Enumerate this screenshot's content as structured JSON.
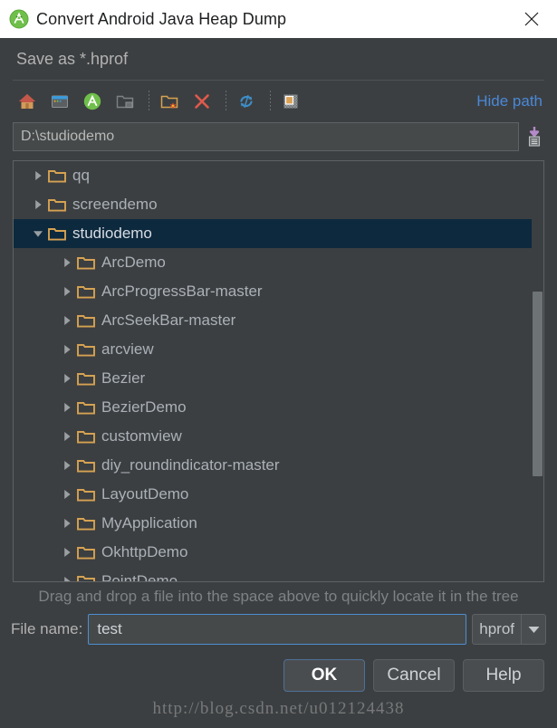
{
  "window": {
    "title": "Convert Android Java Heap Dump",
    "logo_icon": "android-studio-logo",
    "close_icon": "close-icon"
  },
  "dialog": {
    "subheader": "Save as *.hprof"
  },
  "toolbar": {
    "buttons": [
      {
        "name": "home-button",
        "icon": "home-icon",
        "title": "Home"
      },
      {
        "name": "desktop-button",
        "icon": "desktop-icon",
        "title": "Desktop"
      },
      {
        "name": "project-button",
        "icon": "android-studio-icon",
        "title": "Project"
      },
      {
        "name": "up-folder-button",
        "icon": "folder-up-icon",
        "title": "Up"
      },
      {
        "name": "new-folder-button",
        "icon": "new-folder-icon",
        "title": "New Folder"
      },
      {
        "name": "delete-button",
        "icon": "delete-x-icon",
        "title": "Delete"
      },
      {
        "name": "refresh-button",
        "icon": "refresh-icon",
        "title": "Refresh"
      },
      {
        "name": "hidden-files-button",
        "icon": "show-hidden-icon",
        "title": "Show Hidden Files"
      }
    ],
    "hide_path_label": "Hide path"
  },
  "path": {
    "value": "D:\\studiodemo",
    "drop_icon": "paste-down-icon"
  },
  "tree": {
    "rows": [
      {
        "label": "qq",
        "indent": 1,
        "state": "collapsed",
        "selected": false
      },
      {
        "label": "screendemo",
        "indent": 1,
        "state": "collapsed",
        "selected": false
      },
      {
        "label": "studiodemo",
        "indent": 1,
        "state": "expanded",
        "selected": true
      },
      {
        "label": "ArcDemo",
        "indent": 2,
        "state": "collapsed",
        "selected": false
      },
      {
        "label": "ArcProgressBar-master",
        "indent": 2,
        "state": "collapsed",
        "selected": false
      },
      {
        "label": "ArcSeekBar-master",
        "indent": 2,
        "state": "collapsed",
        "selected": false
      },
      {
        "label": "arcview",
        "indent": 2,
        "state": "collapsed",
        "selected": false
      },
      {
        "label": "Bezier",
        "indent": 2,
        "state": "collapsed",
        "selected": false
      },
      {
        "label": "BezierDemo",
        "indent": 2,
        "state": "collapsed",
        "selected": false
      },
      {
        "label": "customview",
        "indent": 2,
        "state": "collapsed",
        "selected": false
      },
      {
        "label": "diy_roundindicator-master",
        "indent": 2,
        "state": "collapsed",
        "selected": false
      },
      {
        "label": "LayoutDemo",
        "indent": 2,
        "state": "collapsed",
        "selected": false
      },
      {
        "label": "MyApplication",
        "indent": 2,
        "state": "collapsed",
        "selected": false
      },
      {
        "label": "OkhttpDemo",
        "indent": 2,
        "state": "collapsed",
        "selected": false
      },
      {
        "label": "PointDemo",
        "indent": 2,
        "state": "collapsed",
        "selected": false
      }
    ],
    "scrollbar": {
      "thumb_top_pct": 31,
      "thumb_height_pct": 44
    }
  },
  "hint": "Drag and drop a file into the space above to quickly locate it in the tree",
  "filename": {
    "label": "File name:",
    "value": "test",
    "extension": "hprof",
    "dropdown_icon": "chevron-down-icon"
  },
  "buttons": {
    "ok": "OK",
    "cancel": "Cancel",
    "help": "Help"
  },
  "watermark": "http://blog.csdn.net/u012124438",
  "colors": {
    "dialog_bg": "#3c3f41",
    "titlebar_bg": "#ffffff",
    "selection_bg": "#0d293e",
    "link_blue": "#4a88d8",
    "focus_border": "#4d8fd1",
    "folder_orange": "#d6a252",
    "text_primary": "#b2b2b2"
  }
}
